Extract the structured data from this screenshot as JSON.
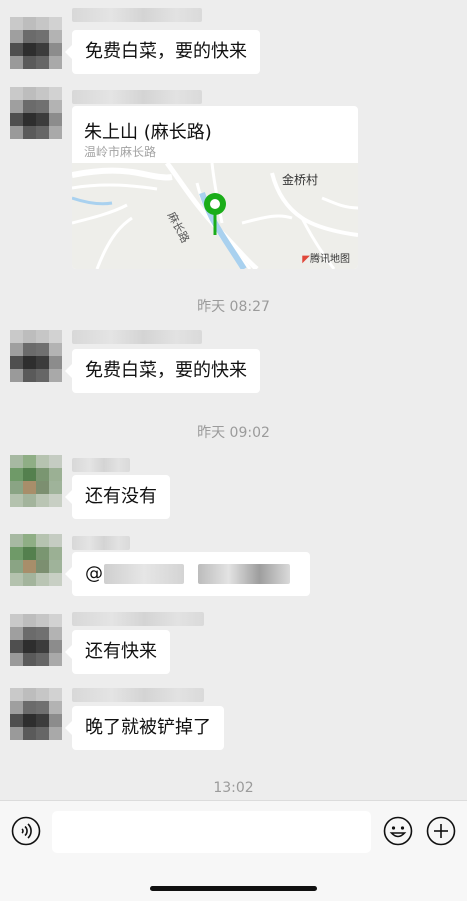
{
  "colors": {
    "background": "#ededed",
    "bubble": "#ffffff",
    "timestamp": "#9b9b9b",
    "pin": "#1aad19"
  },
  "messages": {
    "m1": {
      "text": "免费白菜，要的快来"
    },
    "location": {
      "title": "朱上山 (麻长路)",
      "address": "温岭市麻长路",
      "map_label_village": "金桥村",
      "map_label_road": "麻长路",
      "map_provider": "腾讯地图"
    },
    "m2": {
      "text": "免费白菜，要的快来"
    },
    "m3": {
      "text": "还有没有"
    },
    "m4": {
      "text": "@"
    },
    "m5": {
      "text": "还有快来"
    },
    "m6": {
      "text": "晚了就被铲掉了"
    }
  },
  "timestamps": {
    "t1": "昨天 08:27",
    "t2": "昨天 09:02",
    "t3": "13:02"
  },
  "input_bar": {
    "voice_icon": "voice-icon",
    "emoji_icon": "emoji-icon",
    "add_icon": "plus-icon"
  }
}
